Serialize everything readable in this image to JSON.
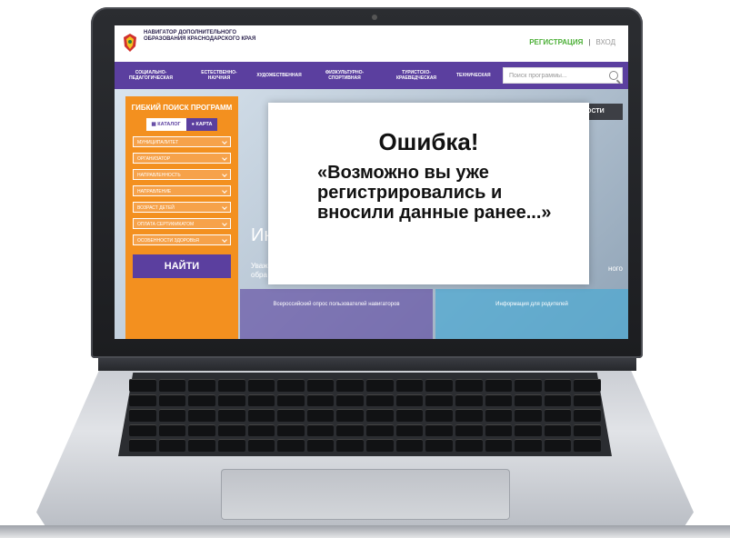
{
  "header": {
    "brand": "НАВИГАТОР ДОПОЛНИТЕЛЬНОГО ОБРАЗОВАНИЯ КРАСНОДАРСКОГО КРАЯ",
    "register": "РЕГИСТРАЦИЯ",
    "separator": "|",
    "login": "ВХОД"
  },
  "nav": {
    "items": [
      "СОЦИАЛЬНО-ПЕДАГОГИЧЕСКАЯ",
      "ЕСТЕСТВЕННО-НАУЧНАЯ",
      "ХУДОЖЕСТВЕННАЯ",
      "ФИЗКУЛЬТУРНО-СПОРТИВНАЯ",
      "ТУРИСТСКО-КРАЕВЕДЧЕСКАЯ",
      "ТЕХНИЧЕСКАЯ"
    ],
    "search_placeholder": "Поиск программы..."
  },
  "sidebar": {
    "title": "ГИБКИЙ ПОИСК ПРОГРАММ",
    "tab_catalog": "КАТАЛОГ",
    "tab_map": "КАРТА",
    "filters": [
      "МУНИЦИПАЛИТЕТ",
      "ОРГАНИЗАТОР",
      "НАПРАВЛЕННОСТЬ",
      "НАПРАВЛЕНИЕ",
      "ВОЗРАСТ ДЕТЕЙ",
      "ОПЛАТА СЕРТИФИКАТОМ",
      "ОСОБЕННОСТИ ЗДОРОВЬЯ"
    ],
    "find_button": "НАЙТИ"
  },
  "banners": {
    "main_heading": "Ин",
    "sub_line1": "Уваж",
    "sub_line2": "обра",
    "right_text": "ного",
    "dark_button": "ОСТИ",
    "left_tile": "Всероссийский опрос пользователей навигаторов",
    "right_tile": "Информация для родителей"
  },
  "modal": {
    "title": "Ошибка!",
    "message": "«Возможно вы уже регистрировались и вносили данные ранее...»"
  },
  "colors": {
    "purple": "#5b3f9f",
    "orange": "#f3901f",
    "green": "#4db038"
  }
}
